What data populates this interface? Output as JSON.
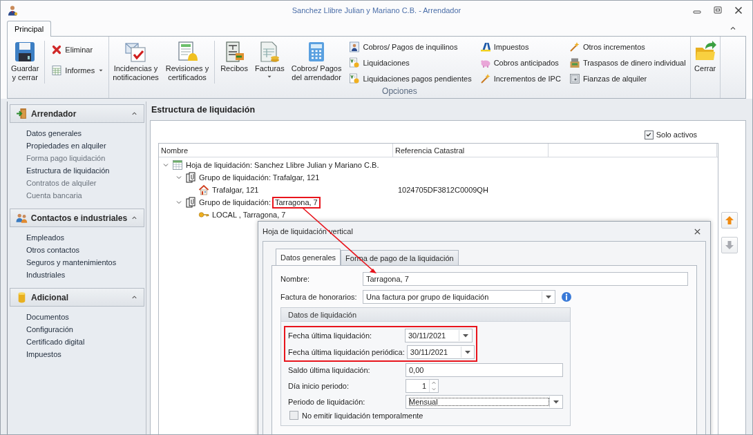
{
  "window": {
    "title": "Sanchez Llibre Julian y Mariano C.B. - Arrendador"
  },
  "ribbon": {
    "tabs": [
      {
        "label": "Principal",
        "selected": true
      }
    ],
    "groups": [
      {
        "sections": [
          {
            "kind": "large",
            "buttons": [
              {
                "label": "Guardar\ny cerrar"
              }
            ]
          },
          {
            "kind": "stack",
            "divided": true,
            "buttons": [
              {
                "label": "Eliminar"
              },
              {
                "label": "Informes",
                "dropdown": true
              }
            ]
          }
        ]
      },
      {
        "label": "Opciones",
        "sections": [
          {
            "kind": "large",
            "buttons": [
              {
                "label": "Incidencias y\nnotificaciones"
              },
              {
                "label": "Revisiones y\ncertificados"
              }
            ]
          },
          {
            "kind": "large",
            "divided": true,
            "buttons": [
              {
                "label": "Recibos"
              },
              {
                "label": "Facturas",
                "dropdown": true
              },
              {
                "label": "Cobros/ Pagos\ndel arrendador"
              }
            ]
          },
          {
            "kind": "stack",
            "buttons": [
              {
                "label": "Cobros/ Pagos de inquilinos"
              },
              {
                "label": "Liquidaciones"
              },
              {
                "label": "Liquidaciones pagos pendientes"
              }
            ]
          },
          {
            "kind": "stack",
            "buttons": [
              {
                "label": "Impuestos"
              },
              {
                "label": "Cobros anticipados"
              },
              {
                "label": "Incrementos de IPC"
              }
            ]
          },
          {
            "kind": "stack",
            "buttons": [
              {
                "label": "Otros incrementos"
              },
              {
                "label": "Traspasos de dinero individual"
              },
              {
                "label": "Fianzas de alquiler"
              }
            ]
          }
        ]
      },
      {
        "sections": [
          {
            "kind": "large",
            "buttons": [
              {
                "label": "Cerrar"
              }
            ]
          }
        ]
      }
    ]
  },
  "sidebar": {
    "sections": [
      {
        "title": "Arrendador",
        "expanded": true,
        "items": [
          {
            "label": "Datos generales",
            "disabled": false
          },
          {
            "label": "Propiedades en alquiler",
            "disabled": false
          },
          {
            "label": "Forma pago liquidación",
            "disabled": true
          },
          {
            "label": "Estructura de liquidación",
            "disabled": false
          },
          {
            "label": "Contratos de alquiler",
            "disabled": true
          },
          {
            "label": "Cuenta bancaria",
            "disabled": true
          }
        ]
      },
      {
        "title": "Contactos e industriales",
        "expanded": true,
        "items": [
          {
            "label": "Empleados",
            "disabled": false
          },
          {
            "label": "Otros contactos",
            "disabled": false
          },
          {
            "label": "Seguros y mantenimientos",
            "disabled": false
          },
          {
            "label": "Industriales",
            "disabled": false
          }
        ]
      },
      {
        "title": "Adicional",
        "expanded": true,
        "items": [
          {
            "label": "Documentos",
            "disabled": false
          },
          {
            "label": "Configuración",
            "disabled": false
          },
          {
            "label": "Certificado digital",
            "disabled": false
          },
          {
            "label": "Impuestos",
            "disabled": false
          }
        ]
      }
    ]
  },
  "main": {
    "title": "Estructura de liquidación",
    "filter": {
      "label": "Solo activos",
      "checked": true
    },
    "tree": {
      "columns": [
        "Nombre",
        "Referencia Catastral"
      ],
      "nodes": [
        {
          "kind": "sheet",
          "label": "Hoja de liquidación: Sanchez Llibre Julian y Mariano C.B.",
          "expanded": true,
          "children": [
            {
              "kind": "group",
              "label": "Grupo de liquidación: Trafalgar, 121",
              "expanded": true,
              "children": [
                {
                  "kind": "building",
                  "label": "Trafalgar, 121",
                  "reference": "1024705DF3812C0009QH"
                }
              ]
            },
            {
              "kind": "group",
              "label": "Grupo de liquidación:",
              "highlighted": "Tarragona, 7",
              "expanded": true,
              "children": [
                {
                  "kind": "local",
                  "label": "LOCAL , Tarragona, 7"
                }
              ]
            }
          ]
        }
      ]
    },
    "move_buttons": [
      {
        "kind": "up",
        "disabled": false
      },
      {
        "kind": "down",
        "disabled": true
      }
    ]
  },
  "dialog": {
    "title": "Hoja de liquidación vertical",
    "tabs": [
      {
        "label": "Datos generales",
        "selected": true
      },
      {
        "label": "Forma de pago de la liquidación",
        "selected": false
      }
    ],
    "fields": [
      {
        "kind": "text",
        "label": "Nombre:",
        "value": "Tarragona, 7"
      },
      {
        "kind": "combo",
        "label": "Factura de honorarios:",
        "value": "Una factura por grupo de liquidación",
        "info": true
      }
    ],
    "group": {
      "title": "Datos de liquidación",
      "highlighted": [
        {
          "kind": "date",
          "label": "Fecha última liquidación:",
          "value": "30/11/2021"
        },
        {
          "kind": "date",
          "label": "Fecha última liquidación periódica:",
          "value": "30/11/2021"
        }
      ],
      "fields": [
        {
          "kind": "text",
          "label": "Saldo última liquidación:",
          "value": "0,00"
        },
        {
          "kind": "spin",
          "label": "Día inicio periodo:",
          "value": "1"
        },
        {
          "kind": "combo",
          "label": "Periodo de liquidación:",
          "value": "Mensual",
          "focused": true
        }
      ],
      "checkbox": {
        "label": "No emitir liquidación temporalmente",
        "checked": false
      }
    }
  }
}
